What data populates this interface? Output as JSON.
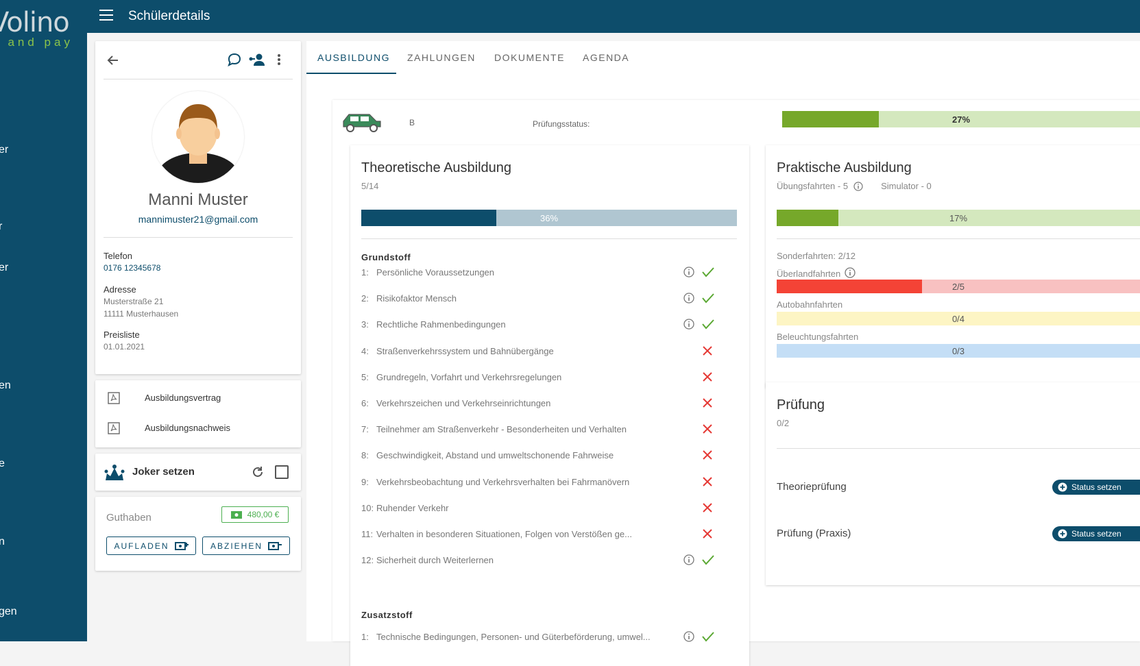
{
  "sidebar": {
    "logo_text": "Volino",
    "logo_sub": ": and pay",
    "fragments": [
      "er",
      "r",
      "er",
      "en",
      "e",
      "n",
      "gen"
    ]
  },
  "topbar": {
    "title": "Schülerdetails"
  },
  "profile": {
    "name": "Manni Muster",
    "email": "mannimuster21@gmail.com",
    "phone_label": "Telefon",
    "phone": "0176 12345678",
    "address_label": "Adresse",
    "address_line1": "Musterstraße 21",
    "address_line2": "11111 Musterhausen",
    "price_label": "Preisliste",
    "price_value": "01.01.2021"
  },
  "documents": [
    {
      "label": "Ausbildungsvertrag"
    },
    {
      "label": "Ausbildungsnachweis"
    }
  ],
  "joker": {
    "label": "Joker setzen"
  },
  "guthaben": {
    "label": "Guthaben",
    "amount": "480,00 €",
    "topup_label": "AUFLADEN",
    "withdraw_label": "ABZIEHEN"
  },
  "tabs": [
    "AUSBILDUNG",
    "ZAHLUNGEN",
    "DOKUMENTE",
    "AGENDA"
  ],
  "license": {
    "class": "B",
    "status_label": "Prüfungsstatus:",
    "status_value": "27%",
    "status_fraction": 0.27
  },
  "theory": {
    "title": "Theoretische Ausbildung",
    "count": "5/14",
    "progress_label": "36%",
    "progress_fraction": 0.36,
    "basic_label": "Grundstoff",
    "basic": [
      {
        "num": "1:",
        "text": "Persönliche Voraussetzungen",
        "done": true
      },
      {
        "num": "2:",
        "text": "Risikofaktor Mensch",
        "done": true
      },
      {
        "num": "3:",
        "text": "Rechtliche Rahmenbedingungen",
        "done": true
      },
      {
        "num": "4:",
        "text": "Straßenverkehrssystem und Bahnübergänge",
        "done": false
      },
      {
        "num": "5:",
        "text": "Grundregeln, Vorfahrt und Verkehrsregelungen",
        "done": false
      },
      {
        "num": "6:",
        "text": "Verkehrszeichen und Verkehrseinrichtungen",
        "done": false
      },
      {
        "num": "7:",
        "text": "Teilnehmer am Straßenverkehr - Besonderheiten und Verhalten",
        "done": false
      },
      {
        "num": "8:",
        "text": "Geschwindigkeit, Abstand und umweltschonende Fahrweise",
        "done": false
      },
      {
        "num": "9:",
        "text": "Verkehrsbeobachtung und Verkehrsverhalten bei Fahrmanövern",
        "done": false
      },
      {
        "num": "10:",
        "text": "Ruhender Verkehr",
        "done": false
      },
      {
        "num": "11:",
        "text": "Verhalten in besonderen Situationen, Folgen von Verstößen ge...",
        "done": false
      },
      {
        "num": "12:",
        "text": "Sicherheit durch Weiterlernen",
        "done": true
      }
    ],
    "extra_label": "Zusatzstoff",
    "extra": [
      {
        "num": "1:",
        "text": "Technische Bedingungen, Personen- und Güterbeförderung, umwel...",
        "done": true
      }
    ]
  },
  "praxis": {
    "title": "Praktische Ausbildung",
    "sub_practice": "Übungsfahrten - 5",
    "sub_sim": "Simulator - 0",
    "progress_label": "17%",
    "progress_fraction": 0.17,
    "special": "Sonderfahrten: 2/12",
    "rides": [
      {
        "label": "Überlandfahrten",
        "value": "2/5",
        "fraction": 0.4,
        "fill": "#f44336",
        "bg": "#f8c1c1",
        "info": true
      },
      {
        "label": "Autobahnfahrten",
        "value": "0/4",
        "fraction": 0,
        "fill": "#fbc02d",
        "bg": "#fdf5c4",
        "info": false
      },
      {
        "label": "Beleuchtungsfahrten",
        "value": "0/3",
        "fraction": 0,
        "fill": "#42a5f5",
        "bg": "#c4def6",
        "info": false
      }
    ]
  },
  "exam": {
    "title": "Prüfung",
    "count": "0/2",
    "items": [
      {
        "label": "Theorieprüfung",
        "button": "Status setzen"
      },
      {
        "label": "Prüfung (Praxis)",
        "button": "Status setzen"
      }
    ]
  },
  "colors": {
    "primary": "#0d4d6b",
    "green": "#76a82a",
    "green_light": "#d4e8be",
    "theory_bg": "#b0c6d1",
    "check": "#5aa832",
    "cross": "#e53935"
  }
}
